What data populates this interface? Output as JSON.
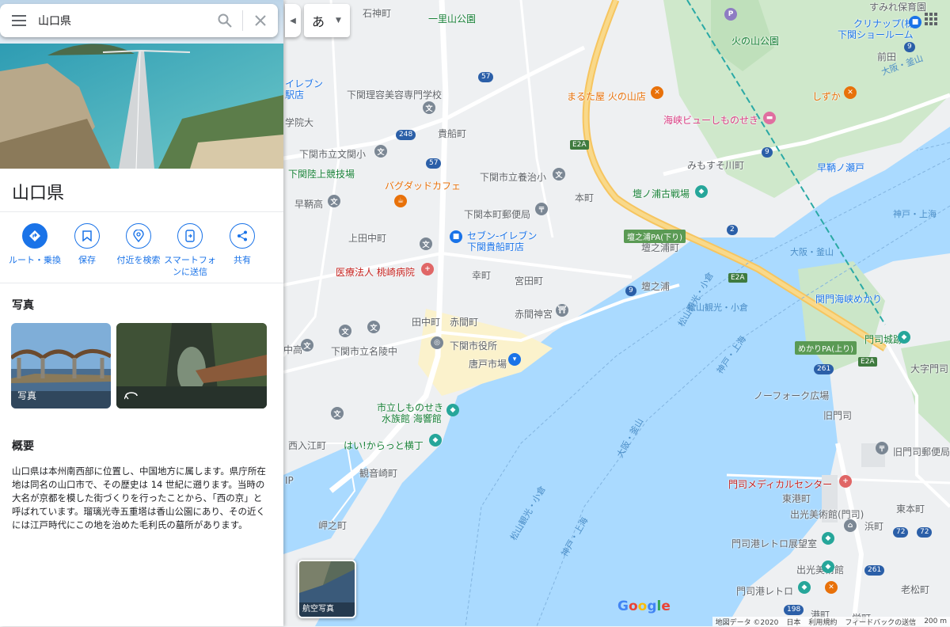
{
  "search": {
    "value": "山口県"
  },
  "ime": {
    "label": "あ"
  },
  "place": {
    "title": "山口県",
    "actions": [
      {
        "label": "ルート・乗換"
      },
      {
        "label": "保存"
      },
      {
        "label": "付近を検索"
      },
      {
        "label": "スマートフォンに送信"
      },
      {
        "label": "共有"
      }
    ],
    "photos_heading": "写真",
    "photo_tiles": [
      {
        "label": "写真"
      },
      {
        "label": ""
      }
    ],
    "overview_heading": "概要",
    "overview_text": "山口県は本州南西部に位置し、中国地方に属します。県庁所在地は同名の山口市で、その歴史は 14 世紀に遡ります。当時の大名が京都を模した街づくりを行ったことから、「西の京」と呼ばれています。瑠璃光寺五重塔は香山公園にあり、その近くには江戸時代にこの地を治めた毛利氏の墓所があります。"
  },
  "map": {
    "aerial_label": "航空写真",
    "logo": "Google",
    "footer": [
      "地図データ ©2020",
      "日本",
      "利用規約",
      "フィードバックの送信",
      "200 m"
    ],
    "labels": [
      {
        "t": "石神町"
      },
      {
        "t": "一里山公園"
      },
      {
        "t": "火の山公園"
      },
      {
        "t": "クリナップ(株)"
      },
      {
        "t": "下関ショールーム"
      },
      {
        "t": "前田"
      },
      {
        "t": "すみれ保育園"
      },
      {
        "t": "イレブン"
      },
      {
        "t": "駅店"
      },
      {
        "t": "下関理容美容専門学校"
      },
      {
        "t": "まるた屋 火の山店"
      },
      {
        "t": "しずか"
      },
      {
        "t": "海峡ビューしものせき"
      },
      {
        "t": "学院大"
      },
      {
        "t": "貴船町"
      },
      {
        "t": "下関市立文関小"
      },
      {
        "t": "みもすそ川町"
      },
      {
        "t": "早鞆ノ瀬戸"
      },
      {
        "t": "下関陸上競技場"
      },
      {
        "t": "下関市立養治小"
      },
      {
        "t": "バグダッドカフェ"
      },
      {
        "t": "本町"
      },
      {
        "t": "壇ノ浦古戦場"
      },
      {
        "t": "早鞆高"
      },
      {
        "t": "下関本町郵便局"
      },
      {
        "t": "神戸・上海"
      },
      {
        "t": "上田中町"
      },
      {
        "t": "セブン-イレブン"
      },
      {
        "t": "下関貴船町店"
      },
      {
        "t": "壇之浦町"
      },
      {
        "t": "大阪・釜山"
      },
      {
        "t": "医療法人 桃崎病院"
      },
      {
        "t": "幸町"
      },
      {
        "t": "宮田町"
      },
      {
        "t": "壇之浦"
      },
      {
        "t": "関門海峡めかり"
      },
      {
        "t": "赤間神宮"
      },
      {
        "t": "松山観光・小倉"
      },
      {
        "t": "田中町"
      },
      {
        "t": "赤間町"
      },
      {
        "t": "中高"
      },
      {
        "t": "下関市立名陵中"
      },
      {
        "t": "下関市役所"
      },
      {
        "t": "門司城跡"
      },
      {
        "t": "唐戸市場"
      },
      {
        "t": "大字門司"
      },
      {
        "t": "ノーフォーク広場"
      },
      {
        "t": "旧門司"
      },
      {
        "t": "市立しものせき"
      },
      {
        "t": "水族館 海響館"
      },
      {
        "t": "西入江町"
      },
      {
        "t": "はい!からっと横丁"
      },
      {
        "t": "旧門司郵便局"
      },
      {
        "t": "観音崎町"
      },
      {
        "t": "門司メディカルセンター"
      },
      {
        "t": "東港町"
      },
      {
        "t": "東本町"
      },
      {
        "t": "出光美術館(門司)"
      },
      {
        "t": "浜町"
      },
      {
        "t": "岬之町"
      },
      {
        "t": "門司港レトロ展望室"
      },
      {
        "t": "出光美術館"
      },
      {
        "t": "門司港レトロ"
      },
      {
        "t": "老松町"
      },
      {
        "t": "港町"
      },
      {
        "t": "栄町"
      },
      {
        "t": "松山観光・小倉"
      },
      {
        "t": "神戸・上海"
      },
      {
        "t": "大阪・釜山"
      },
      {
        "t": "松山観光・小倉"
      },
      {
        "t": "神戸・上海"
      },
      {
        "t": "大阪・釜山"
      },
      {
        "t": "IP"
      },
      {
        "t": "下関市立..."
      }
    ],
    "pa": [
      "壇之浦PA(下り)",
      "めかりPA(上り)"
    ],
    "shields": [
      "E2A",
      "E2A",
      "E2A"
    ],
    "routes": [
      "57",
      "248",
      "57",
      "9",
      "9",
      "2",
      "9",
      "261",
      "72",
      "72",
      "261",
      "198"
    ]
  }
}
